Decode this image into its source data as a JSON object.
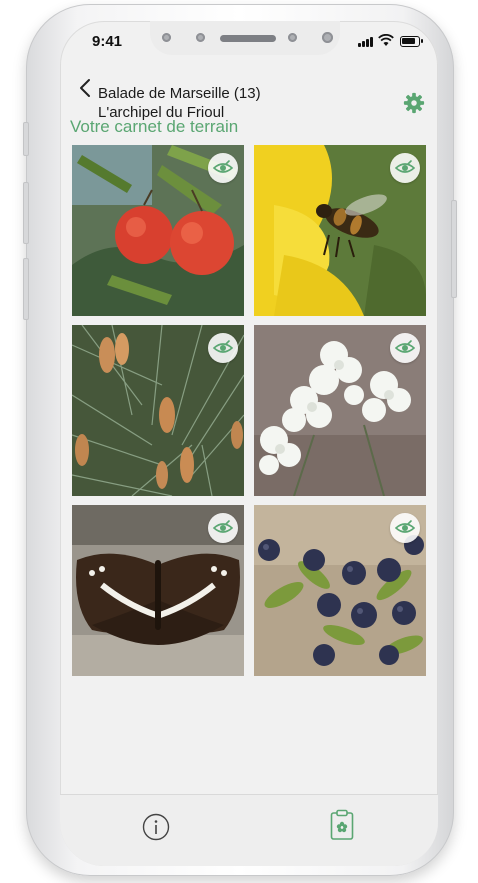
{
  "status": {
    "time": "9:41"
  },
  "header": {
    "title_line1": "Balade de Marseille (13)",
    "title_line2": "L'archipel du Frioul",
    "back_icon": "chevron-left-icon",
    "settings_icon": "gear-icon"
  },
  "section_title": "Votre carnet de terrain",
  "photos": [
    {
      "subject": "arbutus-fruit",
      "icon": "eye-icon"
    },
    {
      "subject": "bee-on-yellow-flower",
      "icon": "eye-icon"
    },
    {
      "subject": "pine-cones",
      "icon": "eye-icon"
    },
    {
      "subject": "white-flowers",
      "icon": "eye-icon"
    },
    {
      "subject": "butterfly",
      "icon": "eye-icon"
    },
    {
      "subject": "blue-berries",
      "icon": "eye-icon"
    }
  ],
  "tabbar": {
    "info_icon": "info-icon",
    "notebook_icon": "clipboard-flower-icon"
  },
  "colors": {
    "accent": "#5aa672",
    "background": "#f1f1f1"
  }
}
